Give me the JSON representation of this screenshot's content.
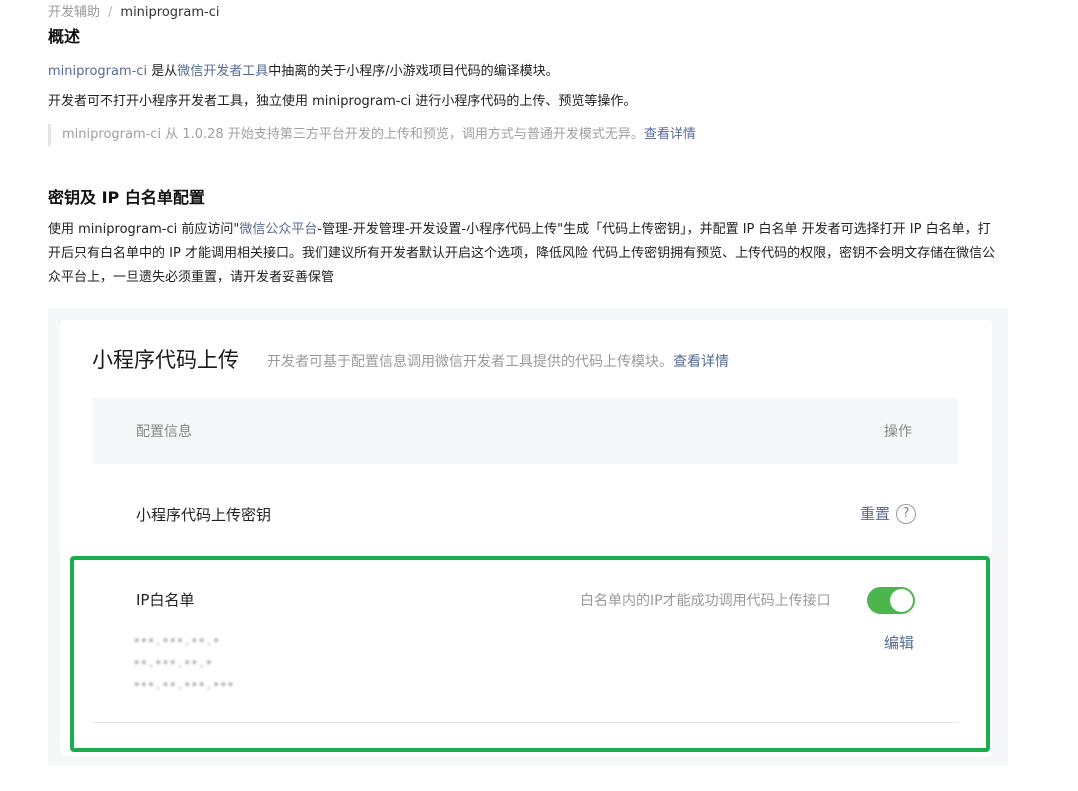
{
  "breadcrumb": {
    "parent": "开发辅助",
    "separator": "/",
    "current": "miniprogram-ci"
  },
  "overview": {
    "title": "概述",
    "line1": {
      "link1": "miniprogram-ci",
      "text1": " 是从",
      "link2": "微信开发者工具",
      "text2": "中抽离的关于小程序/小游戏项目代码的编译模块。"
    },
    "line2": "开发者可不打开小程序开发者工具，独立使用 miniprogram-ci 进行小程序代码的上传、预览等操作。",
    "note": {
      "text": "miniprogram-ci 从 1.0.28 开始支持第三方平台开发的上传和预览，调用方式与普通开发模式无异。",
      "link": "查看详情"
    }
  },
  "key_section": {
    "title": "密钥及 IP 白名单配置",
    "text_before": "使用 miniprogram-ci 前应访问\"",
    "link": "微信公众平台",
    "text_after": "-管理-开发管理-开发设置-小程序代码上传\"生成「代码上传密钥」，并配置 IP 白名单 开发者可选择打开 IP 白名单，打开后只有白名单中的 IP 才能调用相关接口。我们建议所有开发者默认开启这个选项，降低风险 代码上传密钥拥有预览、上传代码的权限，密钥不会明文存储在微信公众平台上，一旦遗失必须重置，请开发者妥善保管"
  },
  "card": {
    "title": "小程序代码上传",
    "description": "开发者可基于配置信息调用微信开发者工具提供的代码上传模块。",
    "description_link": "查看详情",
    "table": {
      "header_config": "配置信息",
      "header_action": "操作"
    },
    "key_row": {
      "label": "小程序代码上传密钥",
      "action": "重置",
      "help_glyph": "?"
    },
    "ip_row": {
      "label": "IP白名单",
      "description": "白名单内的IP才能成功调用代码上传接口",
      "toggle_on": true,
      "action": "编辑",
      "ips": [
        "•••.•••.••.•",
        "••.•••.••.•",
        "•••.••.•••.•••"
      ]
    }
  },
  "colors": {
    "link": "#576b95",
    "toggle_on": "#4cb64c",
    "highlight": "#1aad4b",
    "panel_bg": "#f6f7f9"
  }
}
